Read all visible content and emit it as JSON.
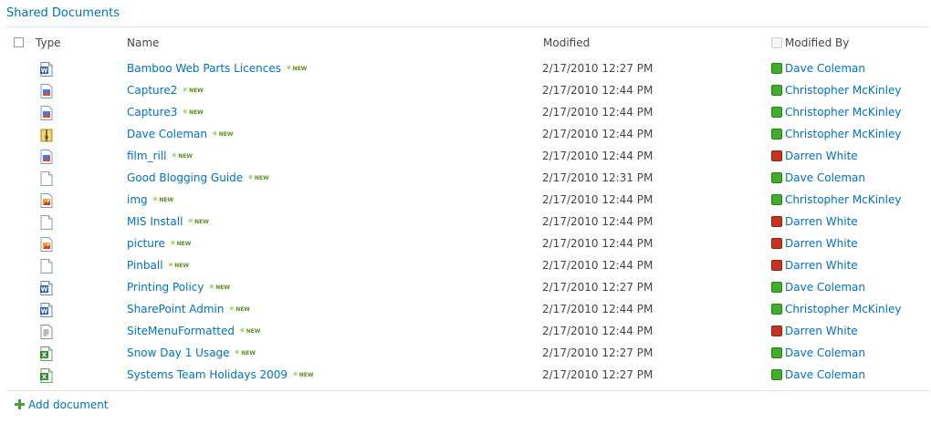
{
  "title": "Shared Documents",
  "columns": {
    "type": "Type",
    "name": "Name",
    "modified": "Modified",
    "modified_by": "Modified By"
  },
  "new_tag": "NEW",
  "add_document": "Add document",
  "colors": {
    "link": "#0072bc",
    "presence_online": "#3fae29",
    "presence_busy": "#c8321e"
  },
  "rows": [
    {
      "icon": "word-doc-icon",
      "name": "Bamboo Web Parts Licences",
      "modified": "2/17/2010 12:27 PM",
      "modified_by": "Dave Coleman",
      "presence": "online"
    },
    {
      "icon": "image-file-icon",
      "name": "Capture2",
      "modified": "2/17/2010 12:44 PM",
      "modified_by": "Christopher McKinley",
      "presence": "online"
    },
    {
      "icon": "image-file-icon",
      "name": "Capture3",
      "modified": "2/17/2010 12:44 PM",
      "modified_by": "Christopher McKinley",
      "presence": "online"
    },
    {
      "icon": "zip-file-icon",
      "name": "Dave Coleman",
      "modified": "2/17/2010 12:44 PM",
      "modified_by": "Christopher McKinley",
      "presence": "online"
    },
    {
      "icon": "image-file-icon",
      "name": "film_rill",
      "modified": "2/17/2010 12:44 PM",
      "modified_by": "Darren White",
      "presence": "busy"
    },
    {
      "icon": "blank-file-icon",
      "name": "Good Blogging Guide",
      "modified": "2/17/2010 12:31 PM",
      "modified_by": "Dave Coleman",
      "presence": "online"
    },
    {
      "icon": "picture-file-icon",
      "name": "img",
      "modified": "2/17/2010 12:44 PM",
      "modified_by": "Christopher McKinley",
      "presence": "online"
    },
    {
      "icon": "blank-file-icon",
      "name": "MIS Install",
      "modified": "2/17/2010 12:44 PM",
      "modified_by": "Darren White",
      "presence": "busy"
    },
    {
      "icon": "picture-file-icon",
      "name": "picture",
      "modified": "2/17/2010 12:44 PM",
      "modified_by": "Darren White",
      "presence": "busy"
    },
    {
      "icon": "blank-file-icon",
      "name": "Pinball",
      "modified": "2/17/2010 12:44 PM",
      "modified_by": "Darren White",
      "presence": "busy"
    },
    {
      "icon": "word-doc-icon",
      "name": "Printing Policy",
      "modified": "2/17/2010 12:27 PM",
      "modified_by": "Dave Coleman",
      "presence": "online"
    },
    {
      "icon": "word-doc-icon",
      "name": "SharePoint Admin",
      "modified": "2/17/2010 12:44 PM",
      "modified_by": "Christopher McKinley",
      "presence": "online"
    },
    {
      "icon": "text-file-icon",
      "name": "SiteMenuFormatted",
      "modified": "2/17/2010 12:44 PM",
      "modified_by": "Darren White",
      "presence": "busy"
    },
    {
      "icon": "excel-doc-icon",
      "name": "Snow Day 1 Usage",
      "modified": "2/17/2010 12:27 PM",
      "modified_by": "Dave Coleman",
      "presence": "online"
    },
    {
      "icon": "excel-doc-icon",
      "name": "Systems Team Holidays 2009",
      "modified": "2/17/2010 12:27 PM",
      "modified_by": "Dave Coleman",
      "presence": "online"
    }
  ]
}
